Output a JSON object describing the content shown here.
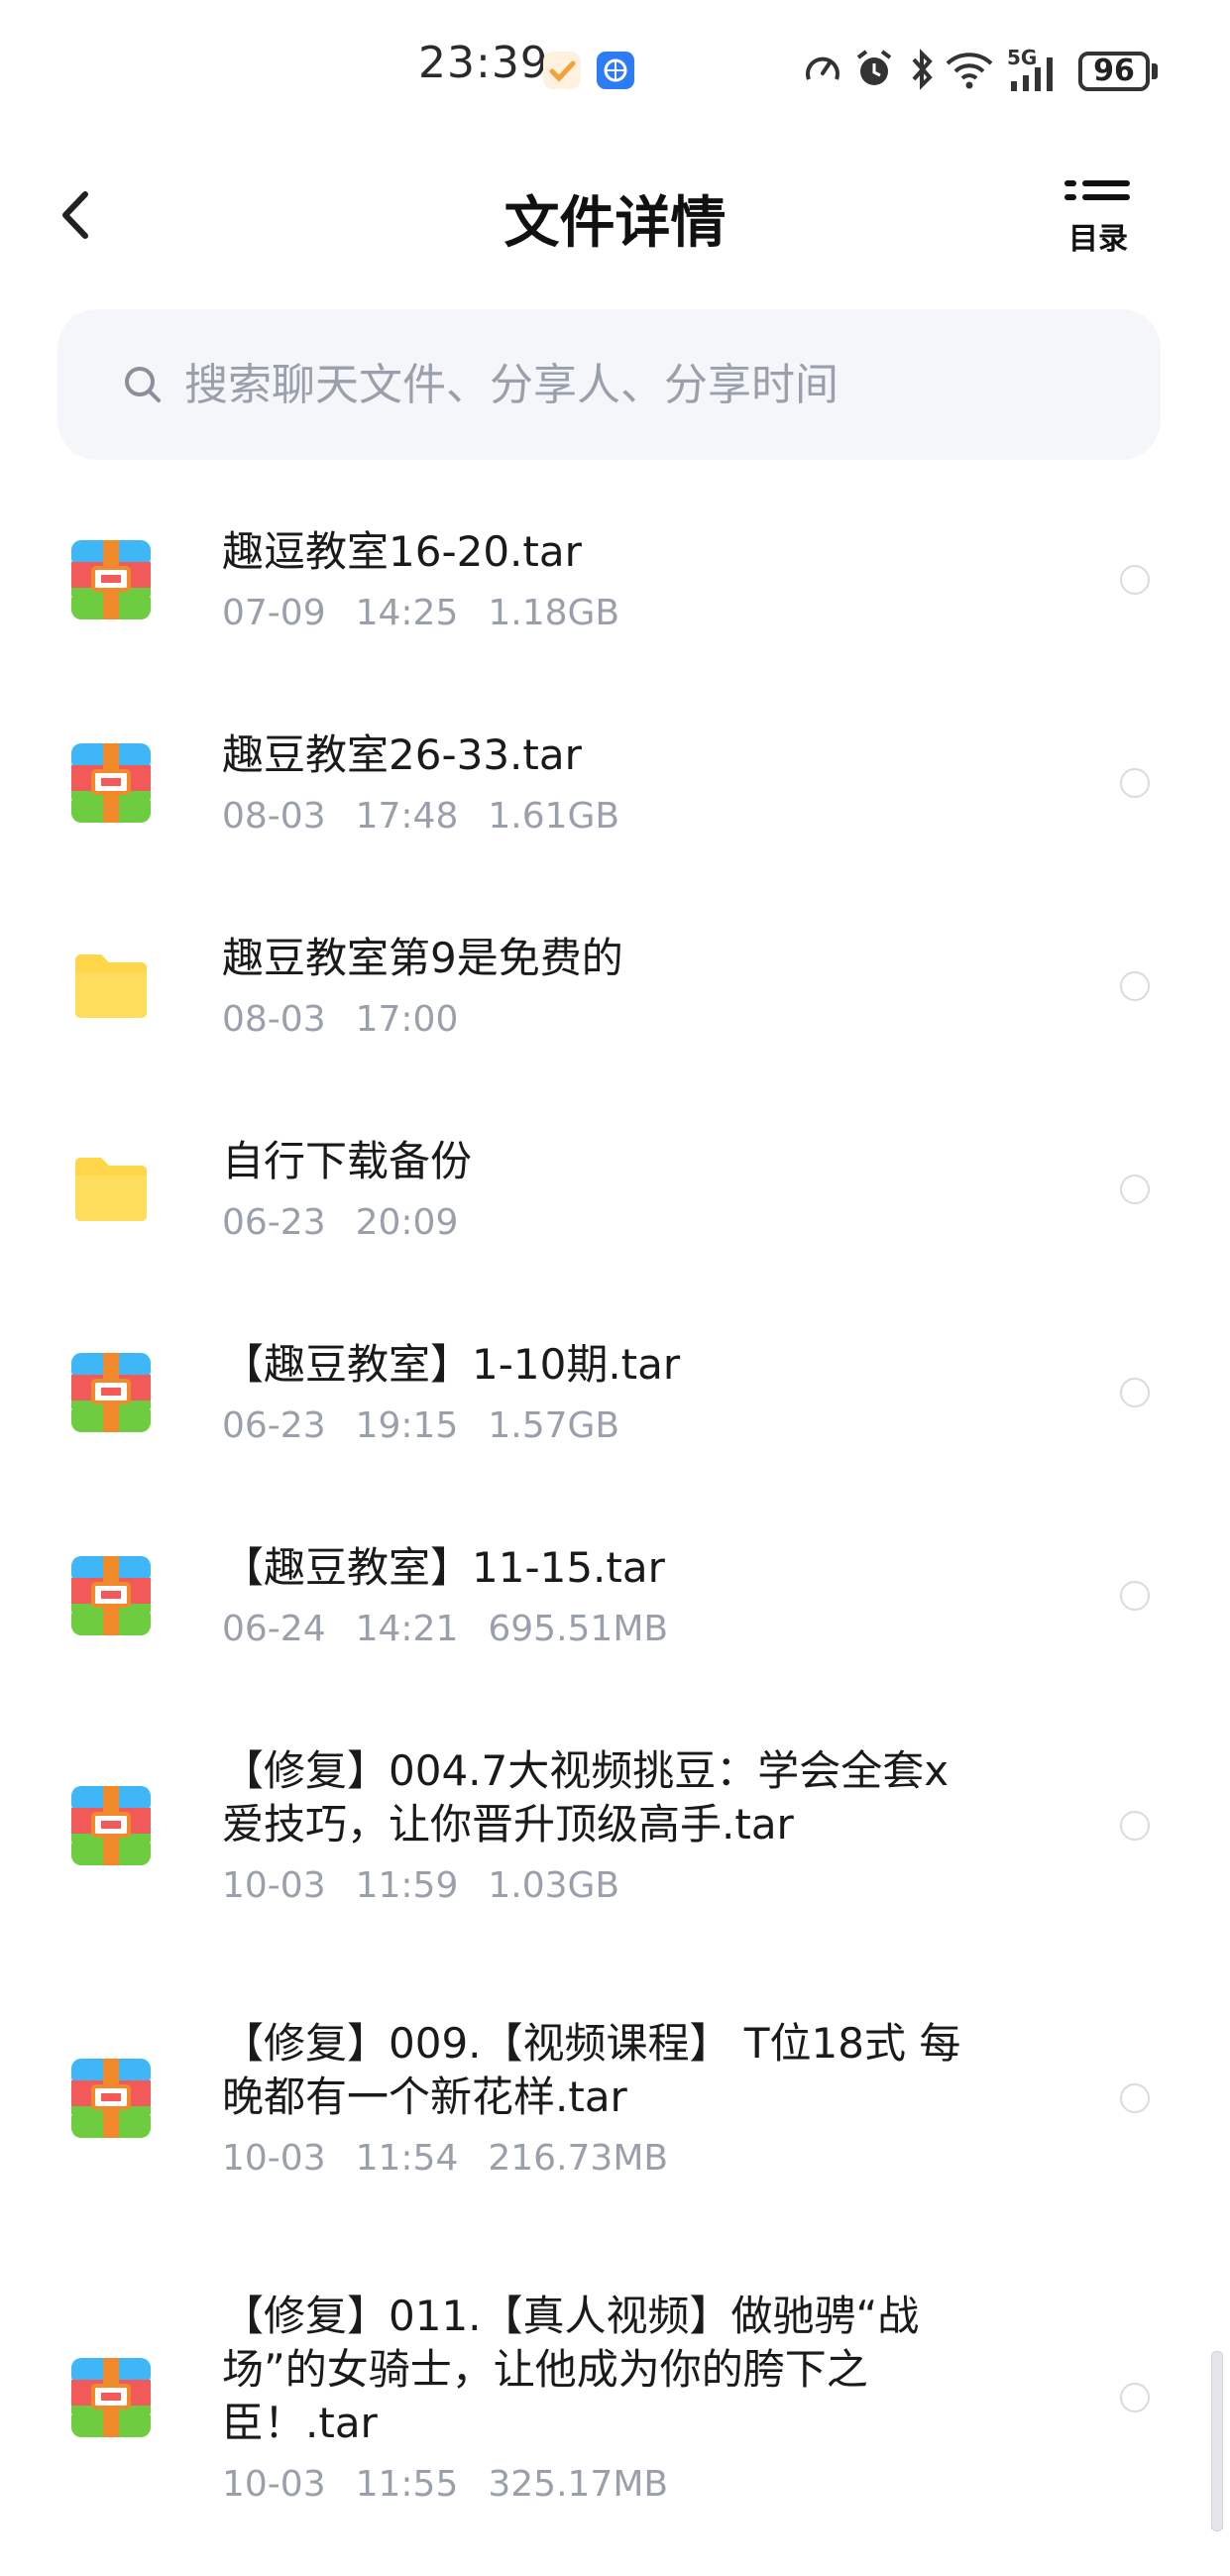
{
  "status_bar": {
    "time": "23:39",
    "battery": "96",
    "network": "5G",
    "icons": [
      "speed-gauge-icon",
      "alarm-icon",
      "bluetooth-icon",
      "wifi-icon",
      "signal-icon",
      "battery-icon"
    ]
  },
  "header": {
    "title": "文件详情",
    "toc_label": "目录"
  },
  "search": {
    "placeholder": "搜索聊天文件、分享人、分享时间"
  },
  "files": [
    {
      "type": "archive",
      "name_lines": [
        "趣逗教室16-20.tar"
      ],
      "date": "07-09",
      "time": "14:25",
      "size": "1.18GB"
    },
    {
      "type": "archive",
      "name_lines": [
        "趣豆教室26-33.tar"
      ],
      "date": "08-03",
      "time": "17:48",
      "size": "1.61GB"
    },
    {
      "type": "folder",
      "name_lines": [
        "趣豆教室第9是免费的"
      ],
      "date": "08-03",
      "time": "17:00",
      "size": ""
    },
    {
      "type": "folder",
      "name_lines": [
        "自行下载备份"
      ],
      "date": "06-23",
      "time": "20:09",
      "size": ""
    },
    {
      "type": "archive",
      "name_lines": [
        "【趣豆教室】1-10期.tar"
      ],
      "date": "06-23",
      "time": "19:15",
      "size": "1.57GB"
    },
    {
      "type": "archive",
      "name_lines": [
        "【趣豆教室】11-15.tar"
      ],
      "date": "06-24",
      "time": "14:21",
      "size": "695.51MB"
    },
    {
      "type": "archive",
      "name_lines": [
        "【修复】004.7大视频挑豆：学会全套x",
        "爱技巧，让你晋升顶级高手.tar"
      ],
      "date": "10-03",
      "time": "11:59",
      "size": "1.03GB"
    },
    {
      "type": "archive",
      "name_lines": [
        "【修复】009.【视频课程】 T位18式 每",
        "晚都有一个新花样.tar"
      ],
      "date": "10-03",
      "time": "11:54",
      "size": "216.73MB"
    },
    {
      "type": "archive",
      "name_lines": [
        "【修复】011.【真人视频】做驰骋“战",
        "场”的女骑士，让他成为你的胯下之",
        "臣！.tar"
      ],
      "date": "10-03",
      "time": "11:55",
      "size": "325.17MB"
    }
  ],
  "colors": {
    "folder": "#ffd64a",
    "archive_top": "#3fb6f5",
    "archive_mid": "#f25a5a",
    "archive_bottom": "#6dcc3f",
    "archive_band": "#f08a2a",
    "meta_text": "#9aa0ab"
  }
}
